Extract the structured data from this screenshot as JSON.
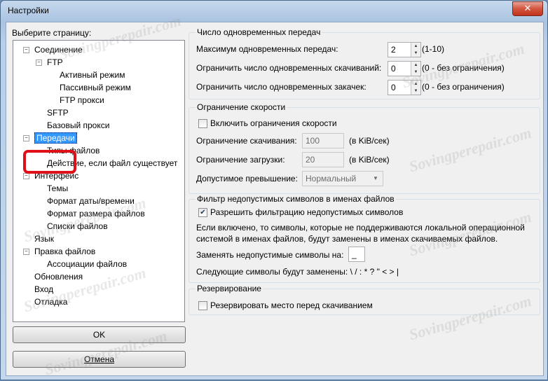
{
  "window": {
    "title": "Настройки",
    "close_glyph": "✕"
  },
  "left": {
    "heading": "Выберите страницу:",
    "tree": [
      {
        "label": "Соединение",
        "level": 0,
        "expander": "−"
      },
      {
        "label": "FTP",
        "level": 1,
        "expander": "−"
      },
      {
        "label": "Активный режим",
        "level": 2
      },
      {
        "label": "Пассивный режим",
        "level": 2
      },
      {
        "label": "FTP прокси",
        "level": 2
      },
      {
        "label": "SFTP",
        "level": 1
      },
      {
        "label": "Базовый прокси",
        "level": 1
      },
      {
        "label": "Передачи",
        "level": 0,
        "expander": "−",
        "selected": true
      },
      {
        "label": "Типы файлов",
        "level": 1
      },
      {
        "label": "Действие, если файл существует",
        "level": 1
      },
      {
        "label": "Интерфейс",
        "level": 0,
        "expander": "−"
      },
      {
        "label": "Темы",
        "level": 1
      },
      {
        "label": "Формат даты/времени",
        "level": 1
      },
      {
        "label": "Формат размера файлов",
        "level": 1
      },
      {
        "label": "Списки файлов",
        "level": 1
      },
      {
        "label": "Язык",
        "level": 0
      },
      {
        "label": "Правка файлов",
        "level": 0,
        "expander": "−"
      },
      {
        "label": "Ассоциации файлов",
        "level": 1
      },
      {
        "label": "Обновления",
        "level": 0
      },
      {
        "label": "Вход",
        "level": 0
      },
      {
        "label": "Отладка",
        "level": 0
      }
    ],
    "ok_label": "OK",
    "cancel_label": "Отмена"
  },
  "concurrent": {
    "title": "Число одновременных передач",
    "max_label": "Максимум одновременных передач:",
    "max_value": "2",
    "max_hint": "(1-10)",
    "dl_label": "Ограничить число одновременных скачиваний:",
    "dl_value": "0",
    "dl_hint": "(0 - без ограничения)",
    "ul_label": "Ограничить число одновременных закачек:",
    "ul_value": "0",
    "ul_hint": "(0 - без ограничения)"
  },
  "speed": {
    "title": "Ограничение скорости",
    "enable_label": "Включить ограничения скорости",
    "dl_label": "Ограничение скачивания:",
    "dl_value": "100",
    "dl_unit": "(в KiB/сек)",
    "ul_label": "Ограничение загрузки:",
    "ul_value": "20",
    "ul_unit": "(в KiB/сек)",
    "burst_label": "Допустимое превышение:",
    "burst_value": "Нормальный"
  },
  "filter": {
    "title": "Фильтр недопустимых символов в именах файлов",
    "enable_label": "Разрешить фильтрацию недопустимых символов",
    "desc1": "Если включено, то символы, которые не поддерживаются локальной операционной",
    "desc2": "системой в именах файлов, будут заменены в именах скачиваемых файлов.",
    "replace_label": "Заменять недопустимые символы на:",
    "replace_value": "_",
    "chars_label": "Следующие символы будут заменены: \\ / : * ? \" < > |"
  },
  "reserve": {
    "title": "Резервирование",
    "label": "Резервировать место перед скачиванием"
  },
  "watermark": "Sovingperepair.com"
}
